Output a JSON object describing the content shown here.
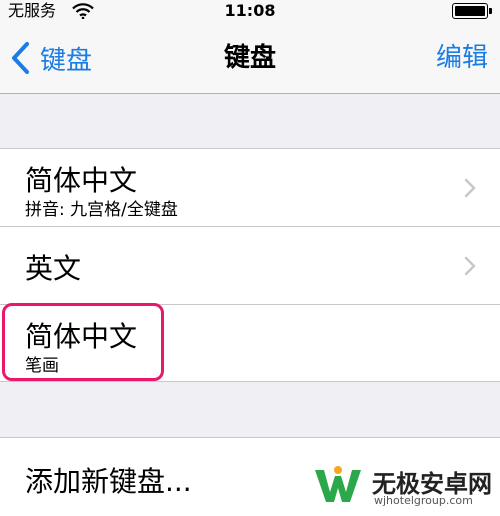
{
  "status_bar": {
    "carrier": "无服务",
    "time": "11:08",
    "battery_level": 1.0
  },
  "nav": {
    "back_label": "键盘",
    "title": "键盘",
    "edit_label": "编辑"
  },
  "keyboards": [
    {
      "title": "简体中文",
      "subtitle": "拼音: 九宫格/全键盘",
      "has_chevron": true
    },
    {
      "title": "英文",
      "subtitle": "",
      "has_chevron": true
    },
    {
      "title": "简体中文",
      "subtitle": "笔画",
      "has_chevron": false,
      "highlighted": true
    }
  ],
  "add_keyboard": {
    "label": "添加新键盘..."
  },
  "watermark": {
    "title": "无极安卓网",
    "url": "wjhotelgroup.com"
  },
  "colors": {
    "accent": "#1a7ce5",
    "highlight": "#e8186b",
    "background": "#efeff4",
    "watermark_green": "#2ba84a"
  }
}
